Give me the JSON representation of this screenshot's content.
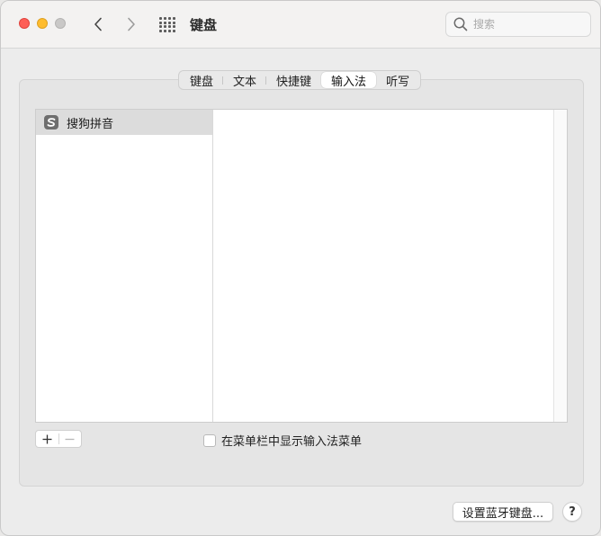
{
  "window": {
    "title": "键盘"
  },
  "search": {
    "placeholder": "搜索"
  },
  "tabs": [
    {
      "label": "键盘",
      "active": false
    },
    {
      "label": "文本",
      "active": false
    },
    {
      "label": "快捷键",
      "active": false
    },
    {
      "label": "输入法",
      "active": true
    },
    {
      "label": "听写",
      "active": false
    }
  ],
  "input_sources": [
    {
      "label": "搜狗拼音",
      "icon": "sogou-icon",
      "selected": true
    }
  ],
  "list_controls": {
    "add_label": "+",
    "remove_label": "−"
  },
  "options": {
    "show_menu_label": "在菜单栏中显示输入法菜单",
    "show_menu_checked": false
  },
  "footer": {
    "bluetooth_button": "设置蓝牙键盘...",
    "help_button": "?"
  },
  "colors": {
    "close": "#fe5f57",
    "minimize": "#febc2e",
    "maximize_disabled": "#c9c8c7",
    "selection": "#dcdcdc"
  }
}
